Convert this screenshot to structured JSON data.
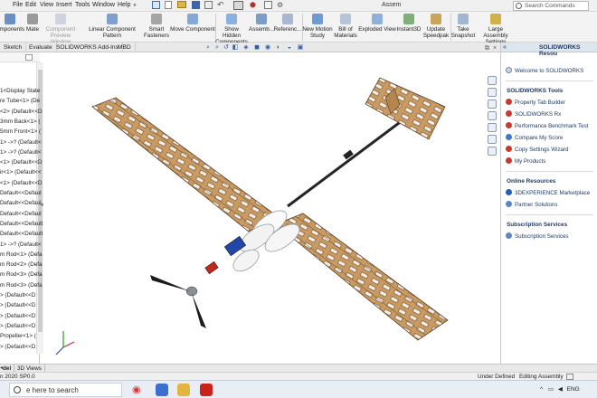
{
  "menubar": {
    "items": [
      "File",
      "Edit",
      "View",
      "Insert",
      "Tools",
      "Window",
      "Help"
    ],
    "title": "Assem",
    "search_placeholder": "Search Commands"
  },
  "ribbon": {
    "components": "omponents",
    "mate": "Mate",
    "component_preview_1": "Component",
    "component_preview_2": "Preview Window",
    "linear_pattern": "Linear Component Pattern",
    "smart_fasteners_1": "Smart",
    "smart_fasteners_2": "Fasteners",
    "move_component": "Move Component",
    "show_hidden_1": "Show Hidden",
    "show_hidden_2": "Components",
    "assembly_features": "Assemb...",
    "reference": "Referenc...",
    "new_motion_1": "New Motion",
    "new_motion_2": "Study",
    "bom_1": "Bill of",
    "bom_2": "Materials",
    "exploded_view": "Exploded View",
    "instant3d": "Instant3D",
    "update_1": "Update",
    "update_2": "Speedpak",
    "snapshot_1": "Take",
    "snapshot_2": "Snapshot",
    "large_assembly_1": "Large Assembly",
    "large_assembly_2": "Settings"
  },
  "tabs": [
    "Sketch",
    "Evaluate",
    "SOLIDWORKS Add-Ins",
    "MBD"
  ],
  "tree": [
    "1<Display State",
    "re Tube<1> (De",
    "<2> (Default<<D",
    "3mm Back<1> (",
    "5mm Front<1> (",
    "1> ->? (Default<",
    "1> ->? (Default<",
    "<1> (Default<<D",
    "ir<1> (Default<<",
    "<1> (Default<<D",
    "Default<<Defaul",
    "Default<<Defaul",
    "Default<<Defaul",
    "Default<<Default",
    "Default<<Default",
    "1> ->? (Default<",
    "m Rod<1> (Defa",
    "m Rod<2> (Defa",
    "m Rod<3> (Defa",
    "m Rod<3> (Defa",
    "> (Default<<D",
    "> (Default<<D",
    "> (Default<<D",
    "> (Default<<D",
    "Propeller<1> (",
    "> (Default<<D"
  ],
  "right_panel": {
    "header": "SOLIDWORKS Resou",
    "welcome": "Welcome to SOLIDWORKS",
    "tools_title": "SOLIDWORKS Tools",
    "tools": [
      "Property Tab Builder",
      "SOLIDWORKS Rx",
      "Performance Benchmark Test",
      "Compare My Score",
      "Copy Settings Wizard",
      "My Products"
    ],
    "online_title": "Online Resources",
    "online": [
      "3DEXPERIENCE Marketplace",
      "Partner Solutions"
    ],
    "subscription_title": "Subscription Services",
    "subscription": [
      "Subscription Services"
    ]
  },
  "bottom_tabs": [
    "del",
    "3D Views"
  ],
  "status": {
    "version": "n 2020 SP0.0",
    "state": "Under Defined",
    "mode": "Editing Assembly"
  },
  "taskbar": {
    "search": "e here to search",
    "language": "ENG"
  },
  "colors": {
    "balsa": "#c99a62",
    "balsa_dark": "#7a5330",
    "accent_blue": "#2446a8",
    "accent_red": "#c0281c"
  }
}
